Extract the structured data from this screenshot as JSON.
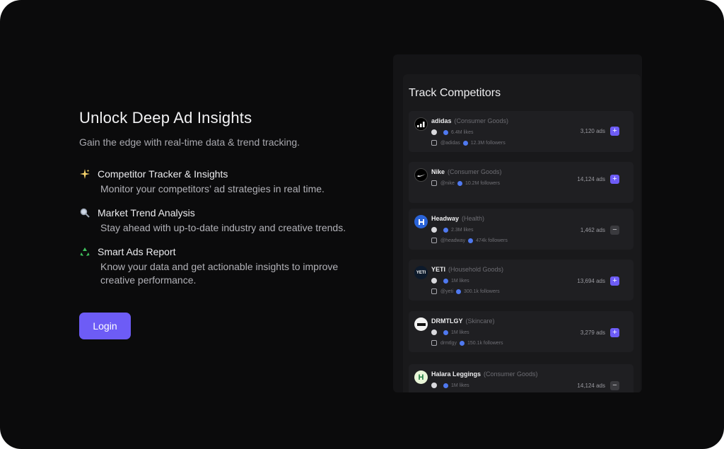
{
  "hero": {
    "title": "Unlock Deep Ad Insights",
    "subtitle": "Gain the edge with real-time data & trend tracking."
  },
  "features": [
    {
      "icon": "sparkles-icon",
      "title": "Competitor Tracker & Insights",
      "desc": "Monitor your competitors’ ad strategies in real time."
    },
    {
      "icon": "magnifier-icon",
      "title": "Market Trend Analysis",
      "desc": "Stay ahead with up-to-date industry and creative trends."
    },
    {
      "icon": "recycle-icon",
      "title": "Smart Ads Report",
      "desc": "Know your data and get actionable insights to improve creative performance."
    }
  ],
  "login_label": "Login",
  "panel": {
    "title": "Track Competitors",
    "competitors": [
      {
        "name": "adidas",
        "category": "(Consumer Goods)",
        "fb": "6.4M likes",
        "ig": "@adidas",
        "followers": "12.3M followers",
        "ads": "3,120 ads",
        "action": "+"
      },
      {
        "name": "Nike",
        "category": "(Consumer Goods)",
        "fb": "",
        "ig": "@nike",
        "followers": "10.2M followers",
        "ads": "14,124 ads",
        "action": "+"
      },
      {
        "name": "Headway",
        "category": "(Health)",
        "fb": "2.3M likes",
        "ig": "@headway",
        "followers": "474k followers",
        "ads": "1,462 ads",
        "action": "−"
      },
      {
        "name": "YETI",
        "category": "(Household Goods)",
        "fb": "1M likes",
        "ig": "@yeti",
        "followers": "300.1k followers",
        "ads": "13,694 ads",
        "action": "+"
      },
      {
        "name": "DRMTLGY",
        "category": "(Skincare)",
        "fb": "1M likes",
        "ig": "drmtlgy",
        "followers": "150.1k followers",
        "ads": "3,279 ads",
        "action": "+"
      },
      {
        "name": "Halara Leggings",
        "category": "(Consumer Goods)",
        "fb": "1M likes",
        "ig": "",
        "followers": "",
        "ads": "14,124 ads",
        "action": "−"
      }
    ]
  },
  "colors": {
    "accent": "#6d5cf6",
    "background": "#0b0b0c",
    "verified": "#4f79f0"
  }
}
